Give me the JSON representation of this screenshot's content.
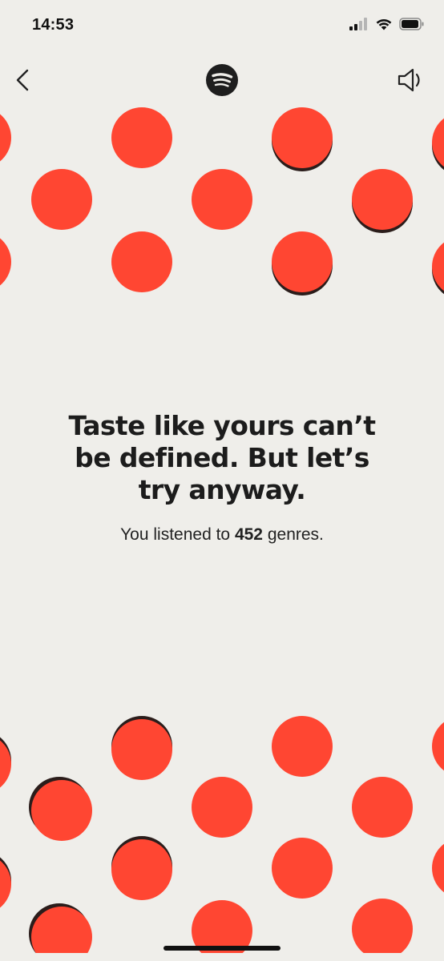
{
  "status_bar": {
    "time": "14:53"
  },
  "nav": {
    "back_icon": "chevron-left-icon",
    "logo_icon": "spotify-logo-icon",
    "sound_icon": "speaker-icon"
  },
  "content": {
    "headline_line1": "Taste like yours can’t",
    "headline_line2": "be defined. But let’s",
    "headline_line3": "try anyway.",
    "sub_prefix": "You listened to",
    "genre_count": "452",
    "sub_suffix": "genres."
  },
  "colors": {
    "background": "#efeeea",
    "dot": "#ff4632",
    "text": "#1c1c1c"
  }
}
